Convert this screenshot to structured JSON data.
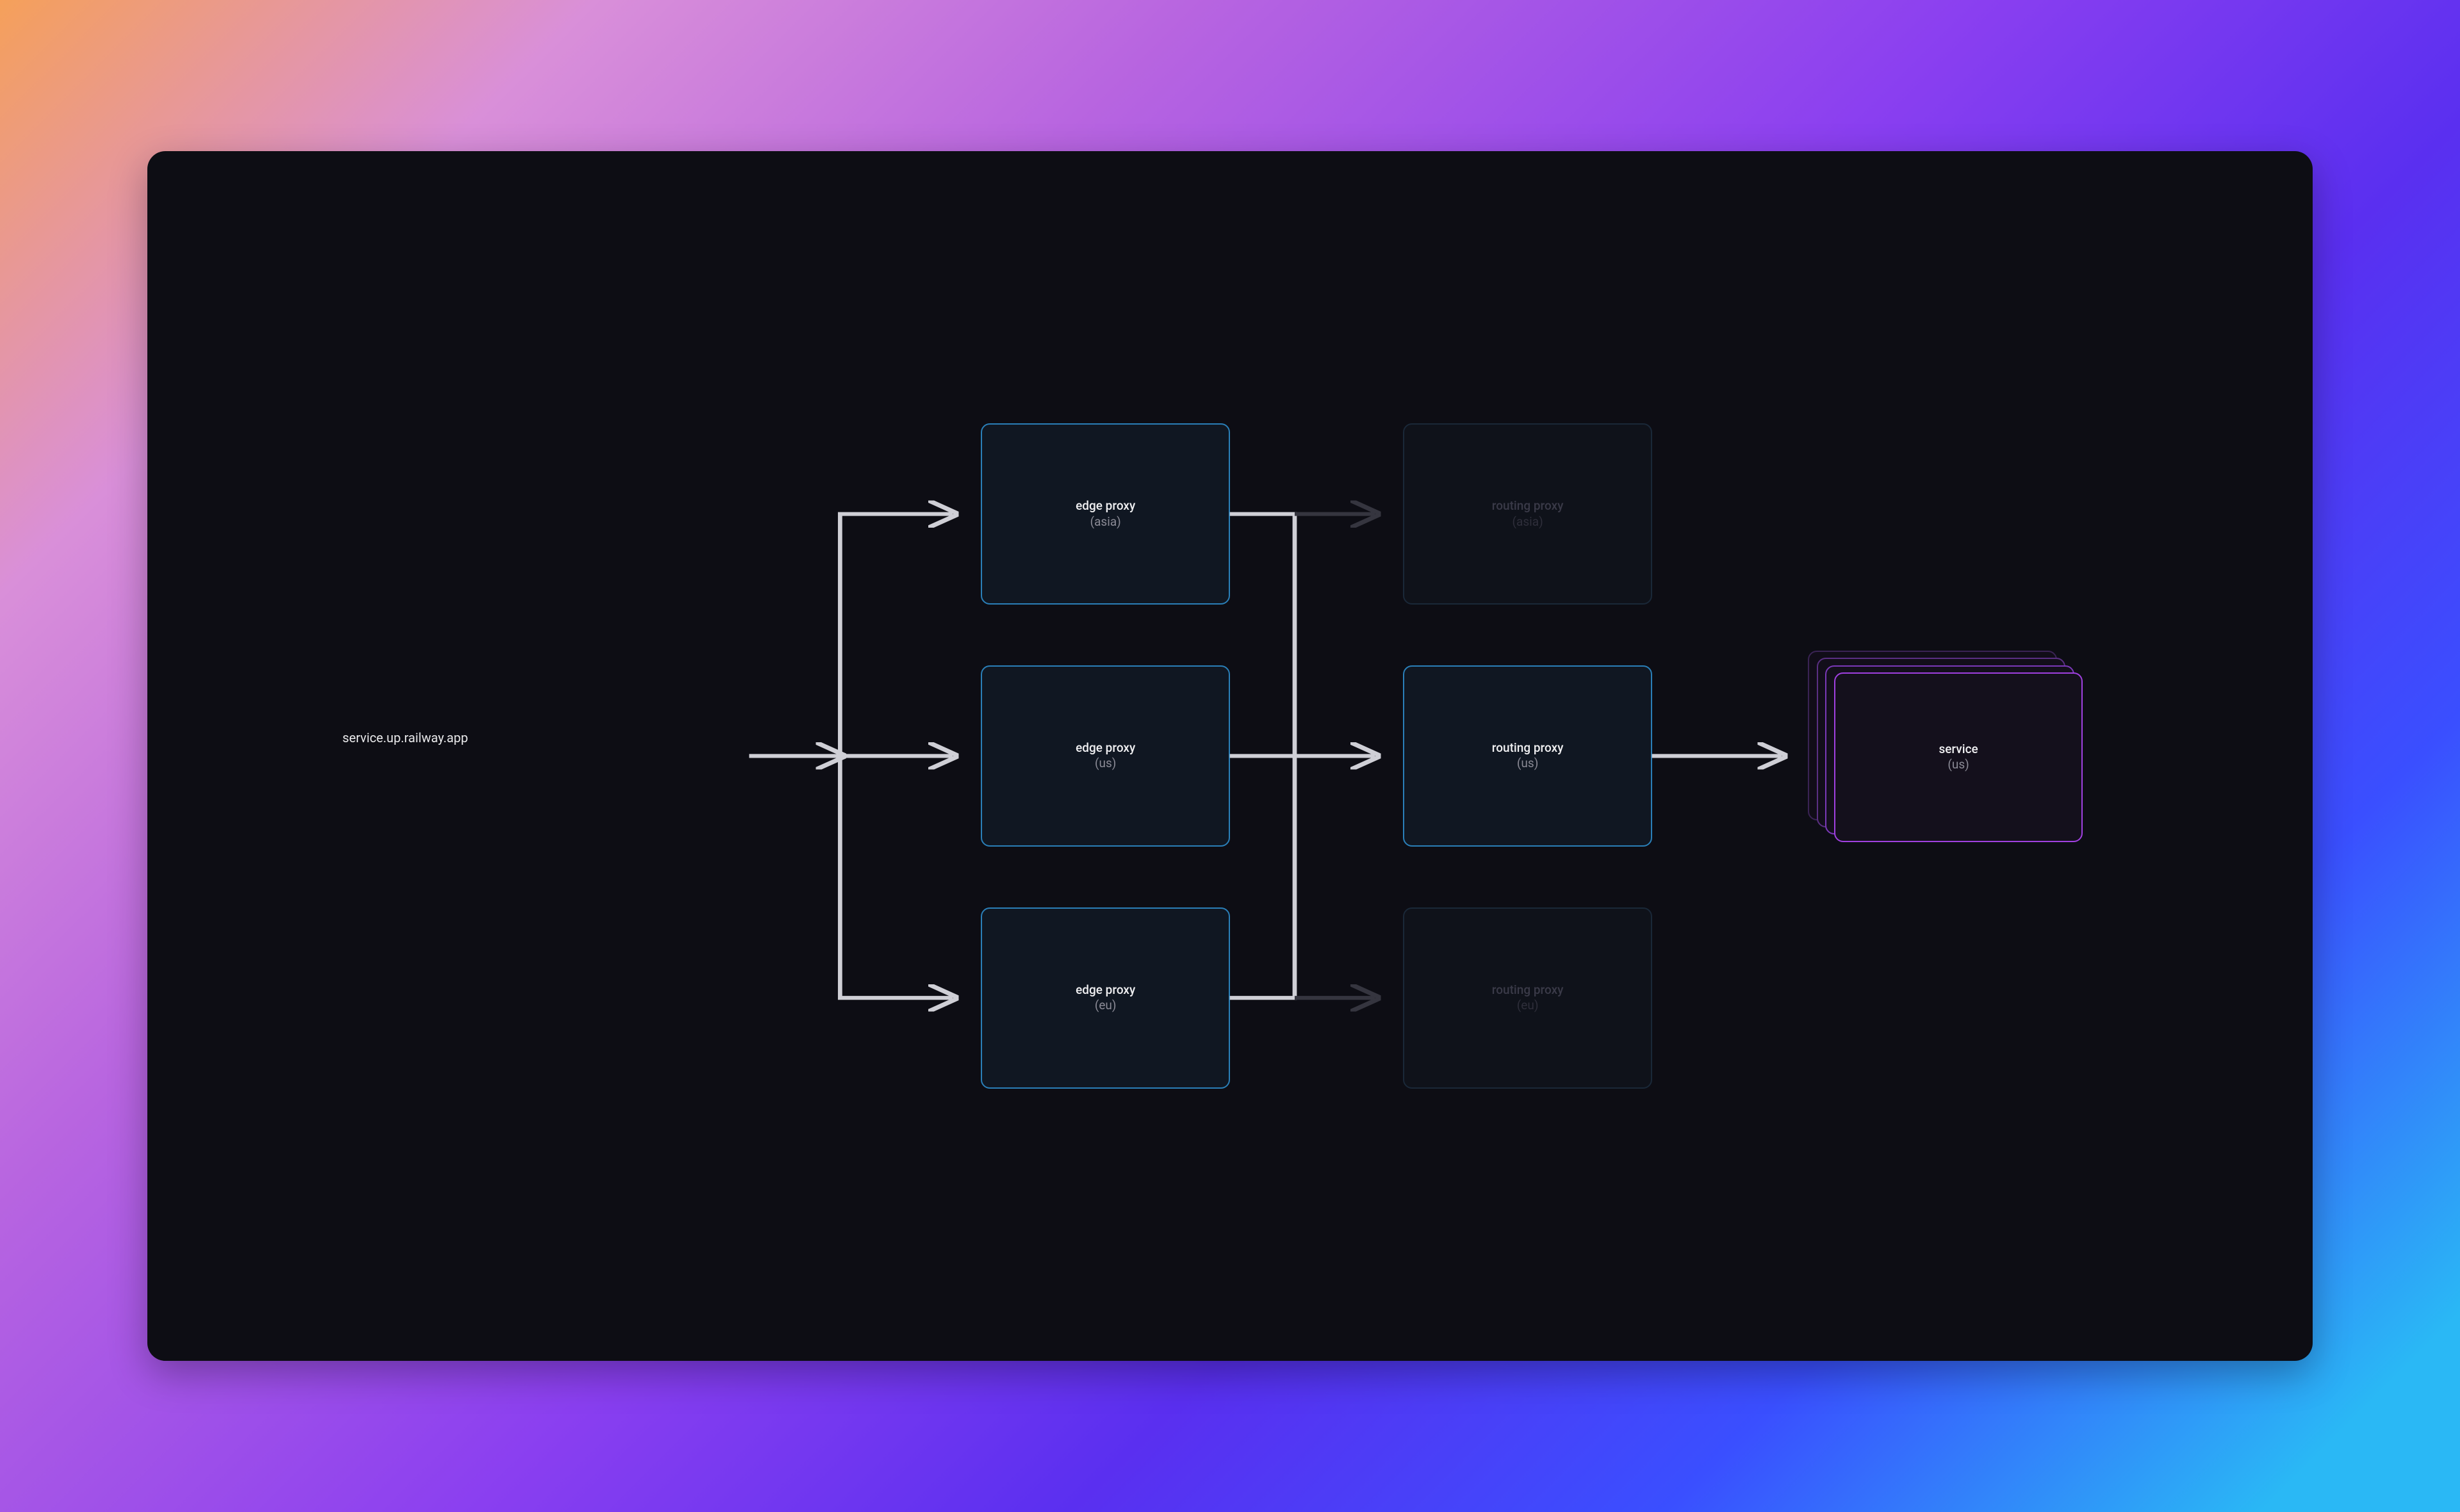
{
  "source_label": "service.up.railway.app",
  "edge_proxies": [
    {
      "title": "edge proxy",
      "region": "(asia)"
    },
    {
      "title": "edge proxy",
      "region": "(us)"
    },
    {
      "title": "edge proxy",
      "region": "(eu)"
    }
  ],
  "routing_proxies": [
    {
      "title": "routing proxy",
      "region": "(asia)",
      "active": false
    },
    {
      "title": "routing proxy",
      "region": "(us)",
      "active": true
    },
    {
      "title": "routing proxy",
      "region": "(eu)",
      "active": false
    }
  ],
  "service": {
    "title": "service",
    "region": "(us)"
  },
  "colors": {
    "blue": "#2a7fb8",
    "purple": "#a040e0",
    "dim_border": "#1a2838",
    "arrow": "#cfcfd6",
    "arrow_dim": "#2a2a35"
  }
}
